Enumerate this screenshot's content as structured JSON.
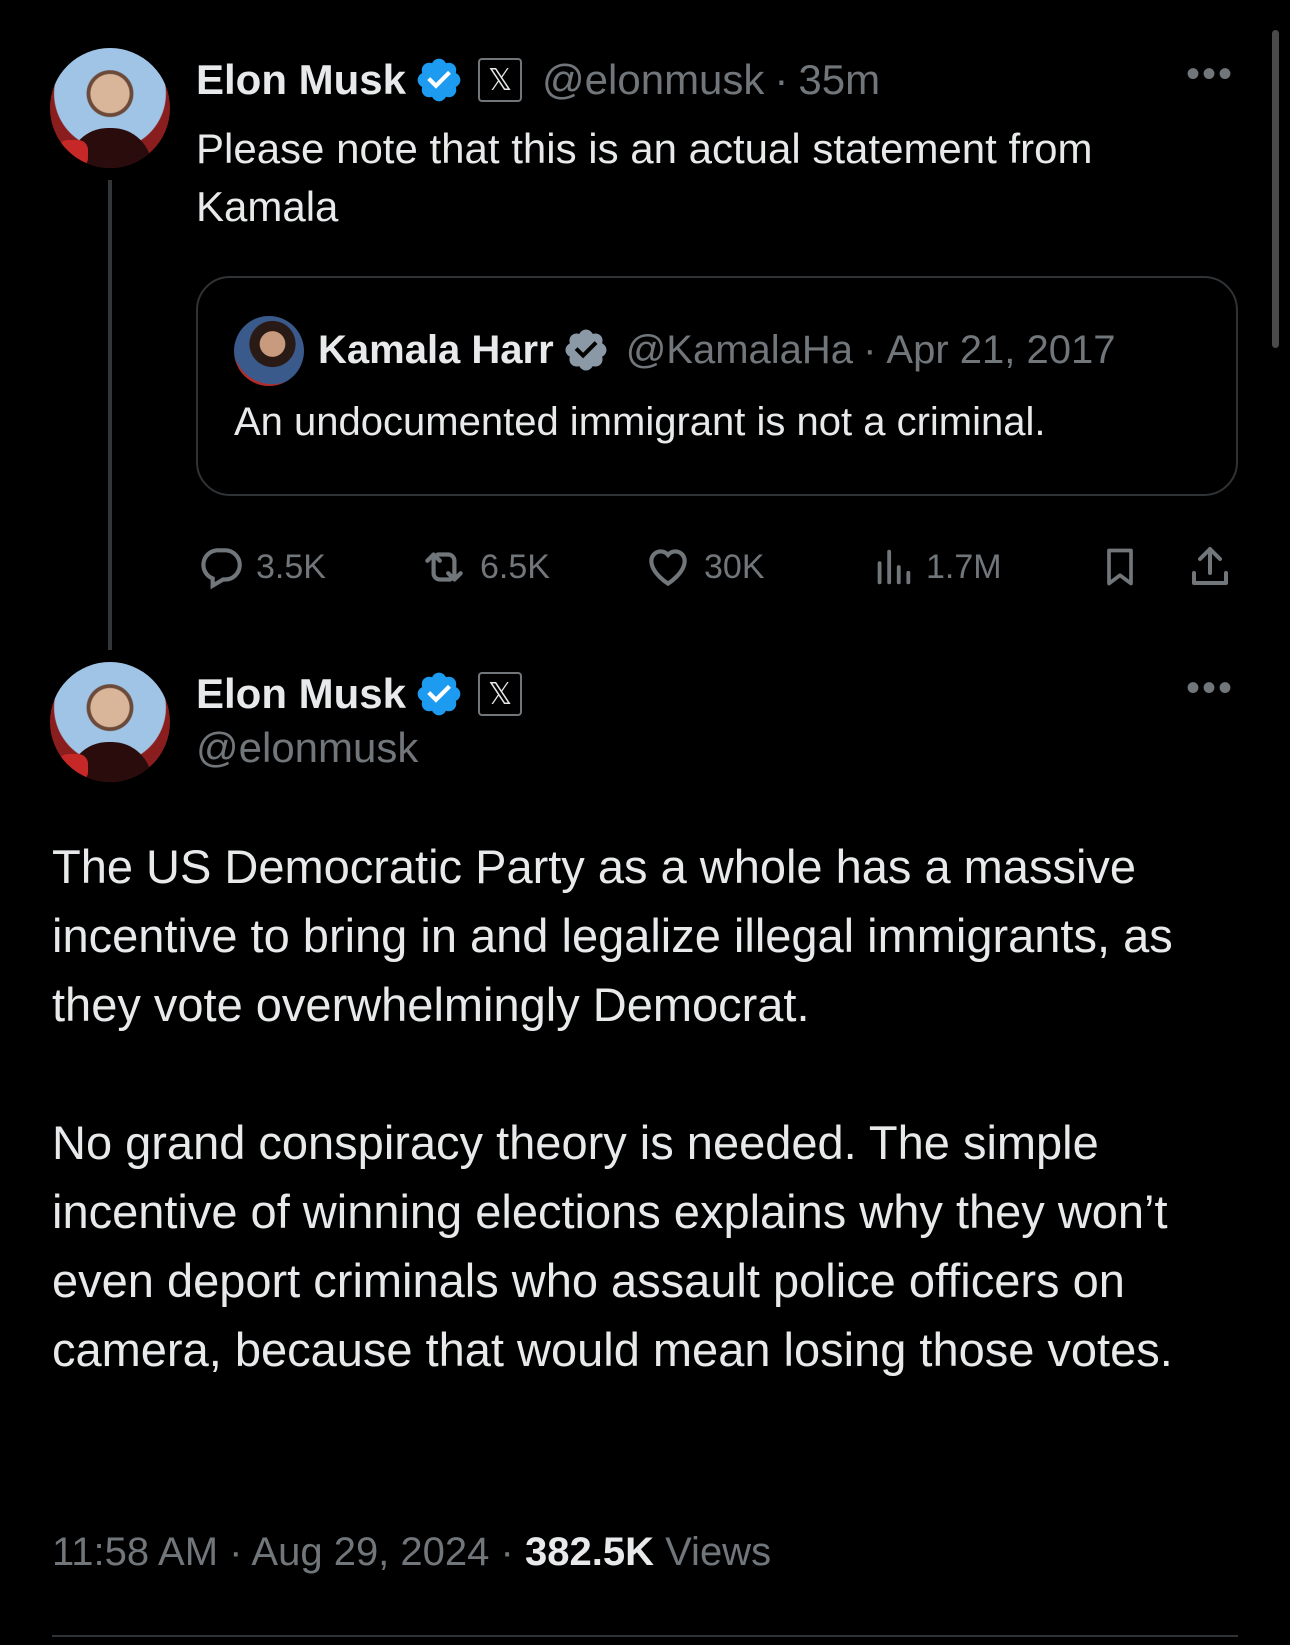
{
  "parent_tweet": {
    "author_name": "Elon Musk",
    "handle": "@elonmusk",
    "time": "35m",
    "separator": "·",
    "text": "Please note that this is an actual statement from Kamala",
    "quote": {
      "author_name": "Kamala Harr",
      "handle": "@KamalaHa",
      "date": "Apr 21, 2017",
      "separator": "·",
      "text": "An undocumented immigrant is not a criminal."
    },
    "stats": {
      "replies": "3.5K",
      "reposts": "6.5K",
      "likes": "30K",
      "views": "1.7M"
    }
  },
  "main_tweet": {
    "author_name": "Elon Musk",
    "handle": "@elonmusk",
    "paragraphs": [
      "The US Democratic Party as a whole has a massive incentive to bring in and legalize illegal immigrants, as they vote overwhelmingly Democrat.",
      "No grand conspiracy theory is needed. The simple incentive of winning elections explains why they won’t even deport criminals who assault police officers on camera, because that would mean losing those votes."
    ],
    "time": "11:58 AM",
    "date": "Aug 29, 2024",
    "separator": "·",
    "view_count": "382.5K",
    "views_label": "Views"
  },
  "icons": {
    "verified": "verified-badge-icon",
    "x_affiliation": "x-logo-icon",
    "more": "more-options-icon",
    "reply": "reply-icon",
    "repost": "repost-icon",
    "like": "heart-icon",
    "views": "analytics-icon",
    "bookmark": "bookmark-icon",
    "share": "share-icon"
  },
  "colors": {
    "background": "#000000",
    "text_primary": "#e7e9ea",
    "text_secondary": "#71767b",
    "verified_blue": "#1d9bf0",
    "border": "#2f3336"
  }
}
